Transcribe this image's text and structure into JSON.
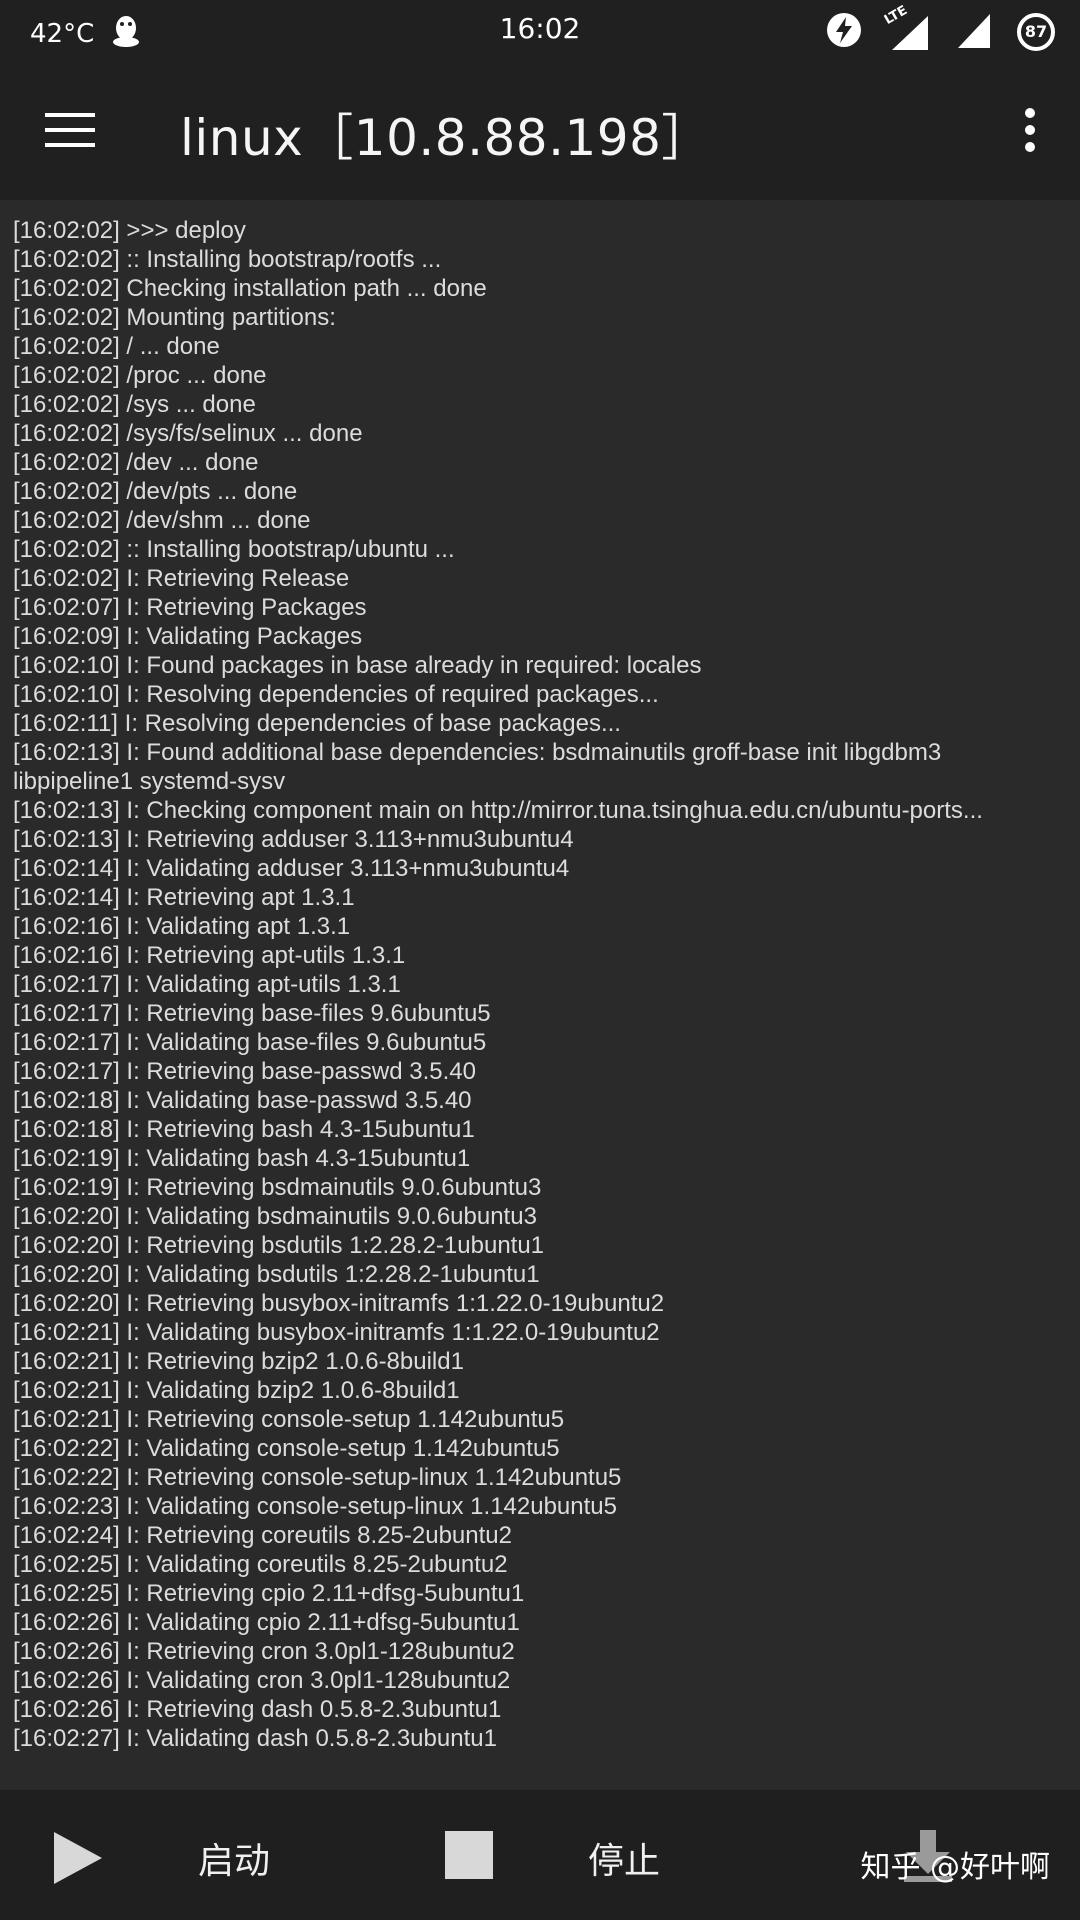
{
  "status_bar": {
    "temperature": "42°C",
    "time": "16:02",
    "network_label": "LTE",
    "battery": "87",
    "icons": [
      "qq-penguin-icon",
      "charging-bolt-icon",
      "lte-signal-icon",
      "signal-icon",
      "battery-icon"
    ]
  },
  "app_bar": {
    "title": "linux［10.8.88.198］",
    "menu_icon": "hamburger-menu-icon",
    "overflow_icon": "more-vert-icon"
  },
  "log": {
    "lines": [
      "[16:02:02] >>> deploy",
      "[16:02:02] :: Installing bootstrap/rootfs ...",
      "[16:02:02] Checking installation path ... done",
      "[16:02:02] Mounting partitions:",
      "[16:02:02] / ... done",
      "[16:02:02] /proc ... done",
      "[16:02:02] /sys ... done",
      "[16:02:02] /sys/fs/selinux ... done",
      "[16:02:02] /dev ... done",
      "[16:02:02] /dev/pts ... done",
      "[16:02:02] /dev/shm ... done",
      "[16:02:02] :: Installing bootstrap/ubuntu ...",
      "[16:02:02] I: Retrieving Release",
      "[16:02:07] I: Retrieving Packages",
      "[16:02:09] I: Validating Packages",
      "[16:02:10] I: Found packages in base already in required: locales",
      "[16:02:10] I: Resolving dependencies of required packages...",
      "[16:02:11] I: Resolving dependencies of base packages...",
      "[16:02:13] I: Found additional base dependencies: bsdmainutils groff-base init libgdbm3 libpipeline1 systemd-sysv",
      "[16:02:13] I: Checking component main on http://mirror.tuna.tsinghua.edu.cn/ubuntu-ports...",
      "[16:02:13] I: Retrieving adduser 3.113+nmu3ubuntu4",
      "[16:02:14] I: Validating adduser 3.113+nmu3ubuntu4",
      "[16:02:14] I: Retrieving apt 1.3.1",
      "[16:02:16] I: Validating apt 1.3.1",
      "[16:02:16] I: Retrieving apt-utils 1.3.1",
      "[16:02:17] I: Validating apt-utils 1.3.1",
      "[16:02:17] I: Retrieving base-files 9.6ubuntu5",
      "[16:02:17] I: Validating base-files 9.6ubuntu5",
      "[16:02:17] I: Retrieving base-passwd 3.5.40",
      "[16:02:18] I: Validating base-passwd 3.5.40",
      "[16:02:18] I: Retrieving bash 4.3-15ubuntu1",
      "[16:02:19] I: Validating bash 4.3-15ubuntu1",
      "[16:02:19] I: Retrieving bsdmainutils 9.0.6ubuntu3",
      "[16:02:20] I: Validating bsdmainutils 9.0.6ubuntu3",
      "[16:02:20] I: Retrieving bsdutils 1:2.28.2-1ubuntu1",
      "[16:02:20] I: Validating bsdutils 1:2.28.2-1ubuntu1",
      "[16:02:20] I: Retrieving busybox-initramfs 1:1.22.0-19ubuntu2",
      "[16:02:21] I: Validating busybox-initramfs 1:1.22.0-19ubuntu2",
      "[16:02:21] I: Retrieving bzip2 1.0.6-8build1",
      "[16:02:21] I: Validating bzip2 1.0.6-8build1",
      "[16:02:21] I: Retrieving console-setup 1.142ubuntu5",
      "[16:02:22] I: Validating console-setup 1.142ubuntu5",
      "[16:02:22] I: Retrieving console-setup-linux 1.142ubuntu5",
      "[16:02:23] I: Validating console-setup-linux 1.142ubuntu5",
      "[16:02:24] I: Retrieving coreutils 8.25-2ubuntu2",
      "[16:02:25] I: Validating coreutils 8.25-2ubuntu2",
      "[16:02:25] I: Retrieving cpio 2.11+dfsg-5ubuntu1",
      "[16:02:26] I: Validating cpio 2.11+dfsg-5ubuntu1",
      "[16:02:26] I: Retrieving cron 3.0pl1-128ubuntu2",
      "[16:02:26] I: Validating cron 3.0pl1-128ubuntu2",
      "[16:02:26] I: Retrieving dash 0.5.8-2.3ubuntu1",
      "[16:02:27] I: Validating dash 0.5.8-2.3ubuntu1"
    ]
  },
  "bottom_bar": {
    "start_label": "启动",
    "stop_label": "停止",
    "watermark": "知乎 @好叶啊",
    "icons": [
      "play-icon",
      "stop-icon",
      "download-icon"
    ]
  },
  "colors": {
    "background": "#2a2a2a",
    "bar": "#202020",
    "text": "#dcdcdc",
    "icon": "#d8d8d8"
  }
}
